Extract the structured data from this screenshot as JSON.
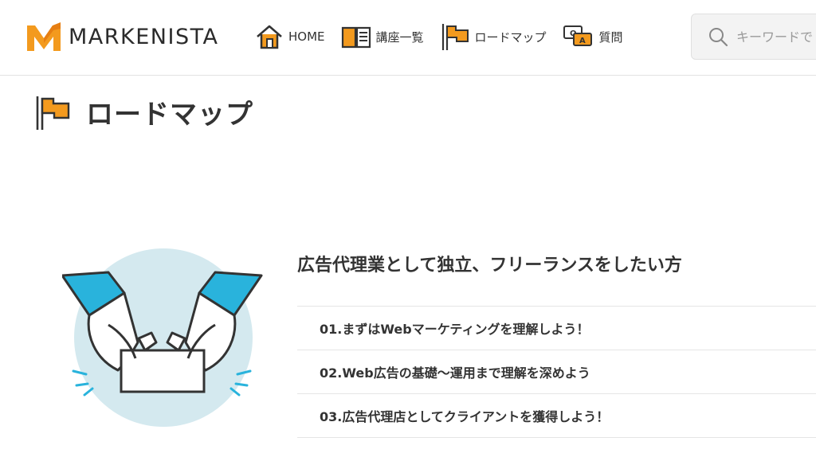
{
  "header": {
    "logo_text": "MARKENISTA",
    "nav": [
      {
        "label": "HOME",
        "icon": "home-icon"
      },
      {
        "label": "講座一覧",
        "icon": "book-icon"
      },
      {
        "label": "ロードマップ",
        "icon": "flag-icon"
      },
      {
        "label": "質問",
        "icon": "qa-icon"
      }
    ],
    "search": {
      "placeholder": "キーワードで"
    }
  },
  "page": {
    "title": "ロードマップ",
    "title_icon": "flag-icon"
  },
  "roadmap": {
    "title": "広告代理業として独立、フリーランスをしたい方",
    "illustration": "hands-holding-card-illustration",
    "steps": [
      "01.まずはWebマーケティングを理解しよう！",
      "02.Web広告の基礎〜運用まで理解を深めよう",
      "03.広告代理店としてクライアントを獲得しよう！"
    ]
  },
  "colors": {
    "accent": "#f39a1e",
    "illustration_bg": "#d4e9ef",
    "sleeve": "#29b3dc"
  }
}
